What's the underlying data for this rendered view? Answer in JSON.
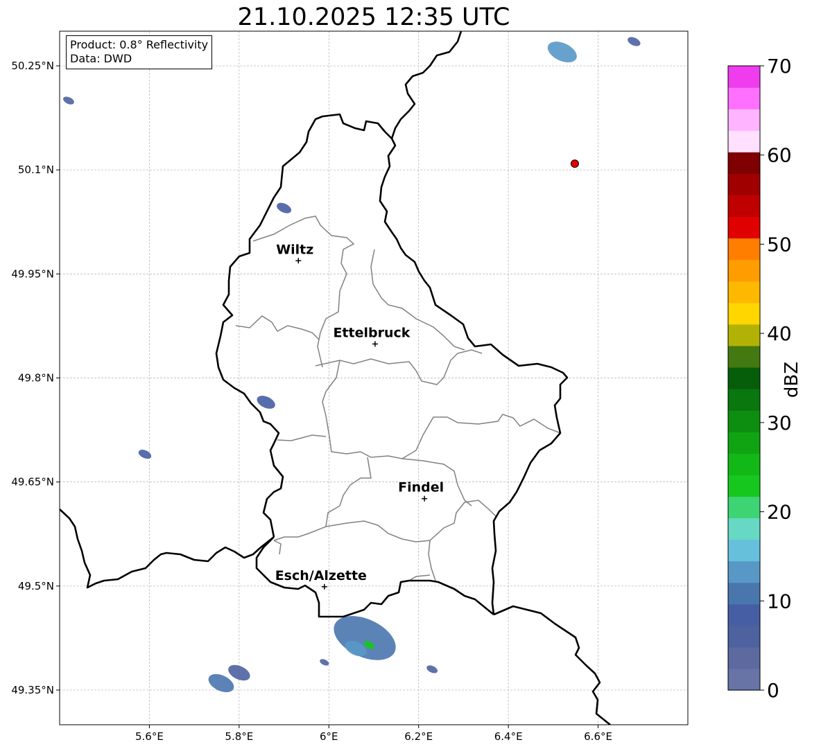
{
  "title": "21.10.2025 12:35 UTC",
  "info": {
    "product": "Product: 0.8° Reflectivity",
    "data": "Data: DWD"
  },
  "axes": {
    "lon_range": [
      5.4,
      6.8
    ],
    "lat_range": [
      49.3,
      50.3
    ],
    "x_ticks": [
      {
        "value": 5.6,
        "label": "5.6°E"
      },
      {
        "value": 5.8,
        "label": "5.8°E"
      },
      {
        "value": 6.0,
        "label": "6°E"
      },
      {
        "value": 6.2,
        "label": "6.2°E"
      },
      {
        "value": 6.4,
        "label": "6.4°E"
      },
      {
        "value": 6.6,
        "label": "6.6°E"
      }
    ],
    "y_ticks": [
      {
        "value": 50.25,
        "label": "50.25°N"
      },
      {
        "value": 50.1,
        "label": "50.1°N"
      },
      {
        "value": 49.95,
        "label": "49.95°N"
      },
      {
        "value": 49.8,
        "label": "49.8°N"
      },
      {
        "value": 49.65,
        "label": "49.65°N"
      },
      {
        "value": 49.5,
        "label": "49.5°N"
      },
      {
        "value": 49.35,
        "label": "49.35°N"
      }
    ]
  },
  "cities": [
    {
      "name": "Wiltz",
      "lon": 5.932,
      "lat": 49.969
    },
    {
      "name": "Ettelbruck",
      "lon": 6.103,
      "lat": 49.849
    },
    {
      "name": "Findel",
      "lon": 6.213,
      "lat": 49.626
    },
    {
      "name": "Esch/Alzette",
      "lon": 5.99,
      "lat": 49.499
    }
  ],
  "radar_site": {
    "lon": 6.548,
    "lat": 50.109,
    "color": "#e00000"
  },
  "colorbar": {
    "label": "dBZ",
    "min": 0,
    "max": 70,
    "ticks": [
      0,
      10,
      20,
      30,
      40,
      50,
      60,
      70
    ],
    "colors": [
      "#6874a6",
      "#5c6aa0",
      "#4e62a0",
      "#465ea3",
      "#4a76ae",
      "#5898c6",
      "#66c0dc",
      "#66d8c4",
      "#3ed474",
      "#16c81e",
      "#12b816",
      "#10a412",
      "#0e8e10",
      "#0a760e",
      "#065e0a",
      "#447810",
      "#b2b206",
      "#ffd600",
      "#ffb800",
      "#ff9c00",
      "#ff7e00",
      "#e00000",
      "#c00000",
      "#a00000",
      "#7e0000",
      "#ffe0ff",
      "#ffb4ff",
      "#ff70ff",
      "#ee3cee"
    ]
  },
  "echoes": [
    {
      "lon": 6.08,
      "lat": 49.425,
      "dbz": 10,
      "r": 34
    },
    {
      "lon": 6.06,
      "lat": 49.41,
      "dbz": 14,
      "r": 12
    },
    {
      "lon": 6.09,
      "lat": 49.415,
      "dbz": 22,
      "r": 6
    },
    {
      "lon": 5.76,
      "lat": 49.36,
      "dbz": 12,
      "r": 14
    },
    {
      "lon": 5.8,
      "lat": 49.375,
      "dbz": 6,
      "r": 12
    },
    {
      "lon": 6.52,
      "lat": 50.27,
      "dbz": 14,
      "r": 16
    },
    {
      "lon": 6.68,
      "lat": 50.285,
      "dbz": 6,
      "r": 7
    },
    {
      "lon": 5.86,
      "lat": 49.765,
      "dbz": 8,
      "r": 10
    },
    {
      "lon": 5.59,
      "lat": 49.69,
      "dbz": 8,
      "r": 7
    },
    {
      "lon": 5.9,
      "lat": 50.045,
      "dbz": 8,
      "r": 8
    },
    {
      "lon": 5.42,
      "lat": 50.2,
      "dbz": 6,
      "r": 6
    },
    {
      "lon": 6.23,
      "lat": 49.38,
      "dbz": 6,
      "r": 6
    },
    {
      "lon": 5.99,
      "lat": 49.39,
      "dbz": 6,
      "r": 5
    }
  ]
}
